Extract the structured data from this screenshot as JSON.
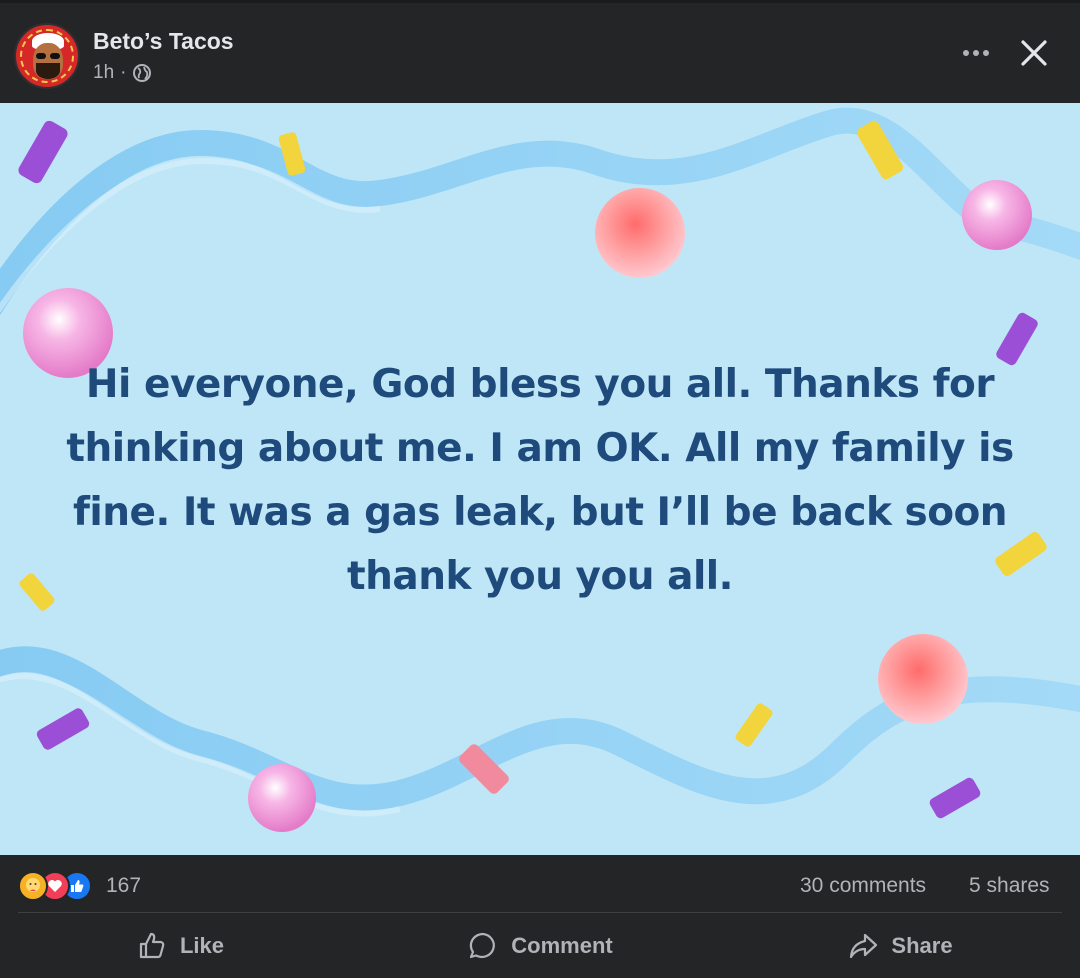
{
  "post": {
    "page_name": "Beto’s Tacos",
    "time": "1h",
    "separator": "·",
    "audience_icon": "globe-icon",
    "image_text": "Hi everyone, God bless you all. Thanks for thinking about me. I am OK. All my family is fine. It was a gas leak, but I’ll be back soon thank you you all.",
    "background_color": "#bfe6f7",
    "text_color": "#1f4a7c"
  },
  "avatar": {
    "logo_text": "BETO'S TACOS"
  },
  "stats": {
    "reaction_icons": [
      "care-icon",
      "love-icon",
      "like-icon"
    ],
    "reaction_count": "167",
    "comments": "30 comments",
    "shares": "5 shares"
  },
  "actions": {
    "like_label": "Like",
    "comment_label": "Comment",
    "share_label": "Share"
  },
  "colors": {
    "dark_bg": "#242526",
    "secondary_text": "#b0b3b8",
    "like_blue": "#1877f2",
    "love_red": "#f33e58",
    "care_yellow": "#f7b125"
  }
}
